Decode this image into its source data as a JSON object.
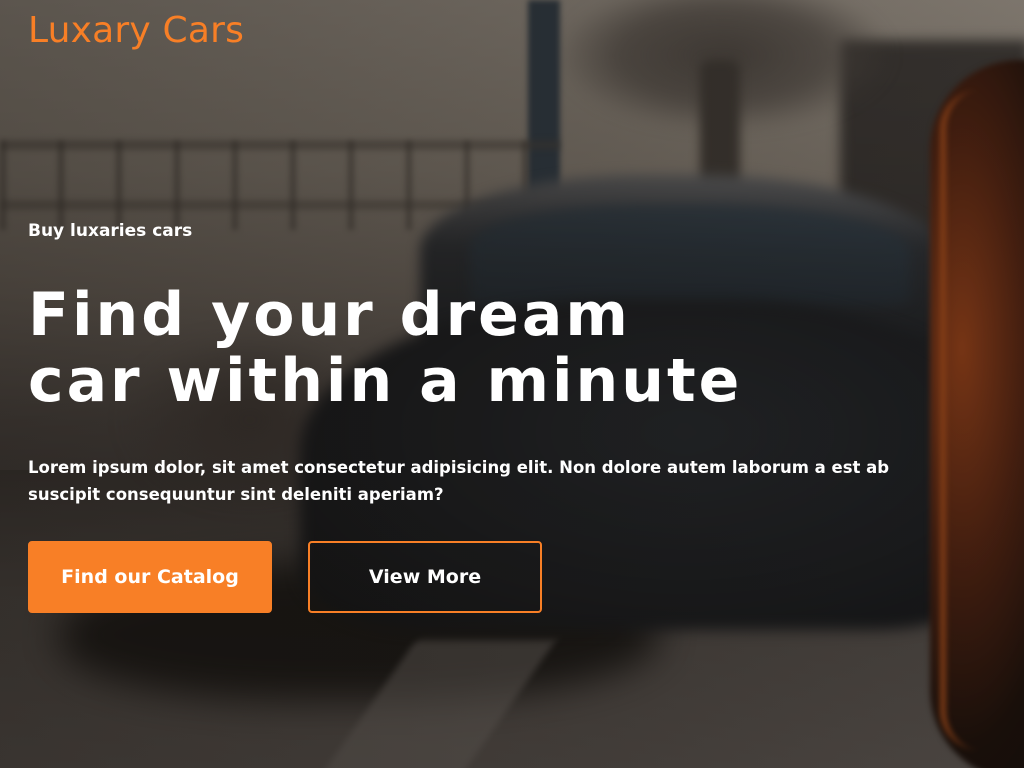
{
  "brand": {
    "name": "Luxary Cars"
  },
  "hero": {
    "eyebrow": "Buy luxaries cars",
    "headline_line1": "Find your dream",
    "headline_line2": "car within a minute",
    "description": "Lorem ipsum dolor, sit amet consectetur adipisicing elit. Non dolore autem laborum a est ab suscipit consequuntur sint deleniti aperiam?"
  },
  "buttons": {
    "primary_label": "Find our Catalog",
    "secondary_label": "View More"
  },
  "colors": {
    "accent": "#f87f26",
    "text": "#ffffff"
  }
}
